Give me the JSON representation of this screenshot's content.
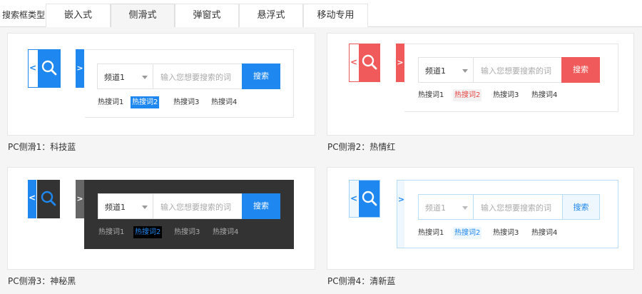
{
  "tabbar": {
    "label": "搜索框类型",
    "tabs": [
      {
        "label": "嵌入式",
        "active": false
      },
      {
        "label": "侧滑式",
        "active": true
      },
      {
        "label": "弹窗式",
        "active": false
      },
      {
        "label": "悬浮式",
        "active": false
      },
      {
        "label": "移动专用",
        "active": false
      }
    ]
  },
  "themes": [
    {
      "caption": "PC侧滑1：科技蓝",
      "collapsed_arrow": "<",
      "expand_arrow": ">",
      "channel": "频道1",
      "placeholder": "输入您想要搜索的词",
      "button": "搜索",
      "hotwords": [
        "热搜词1",
        "热搜词2",
        "热搜词3",
        "热搜词4"
      ],
      "active_hotword": 1,
      "colors": {
        "accent": "#1e87f0",
        "button_text": "#ffffff",
        "panel_bg": "#ffffff",
        "hot_active_text": "#ffffff"
      }
    },
    {
      "caption": "PC侧滑2：热情红",
      "collapsed_arrow": "<",
      "expand_arrow": ">",
      "channel": "频道1",
      "placeholder": "输入您想要搜索的词",
      "button": "搜索",
      "hotwords": [
        "热搜词1",
        "热搜词2",
        "热搜词3",
        "热搜词4"
      ],
      "active_hotword": 1,
      "colors": {
        "accent": "#f05a5a",
        "button_text": "#ffffff",
        "panel_bg": "#ffffff",
        "hot_active_text": "#e84545"
      }
    },
    {
      "caption": "PC侧滑3：神秘黑",
      "collapsed_arrow": "<",
      "expand_arrow": ">",
      "channel": "频道1",
      "placeholder": "输入您想要搜索的词",
      "button": "搜索",
      "hotwords": [
        "热搜词1",
        "热搜词2",
        "热搜词3",
        "热搜词4"
      ],
      "active_hotword": 1,
      "colors": {
        "accent": "#1e87f0",
        "button_text": "#ffffff",
        "panel_bg": "#333333",
        "hot_active_text": "#1e87f0"
      }
    },
    {
      "caption": "PC侧滑4：清新蓝",
      "collapsed_arrow": "<",
      "expand_arrow": ">",
      "channel": "频道1",
      "placeholder": "输入您想要搜索的词",
      "button": "搜索",
      "hotwords": [
        "热搜词1",
        "热搜词2",
        "热搜词3",
        "热搜词4"
      ],
      "active_hotword": 1,
      "colors": {
        "accent": "#1e87f0",
        "button_text": "#1e87f0",
        "panel_bg": "#ffffff",
        "hot_active_text": "#1e87f0"
      }
    }
  ],
  "icons": {
    "search": "magnifier-icon",
    "collapse": "chevron-left-icon",
    "expand": "chevron-right-icon",
    "dropdown": "caret-down-icon"
  }
}
